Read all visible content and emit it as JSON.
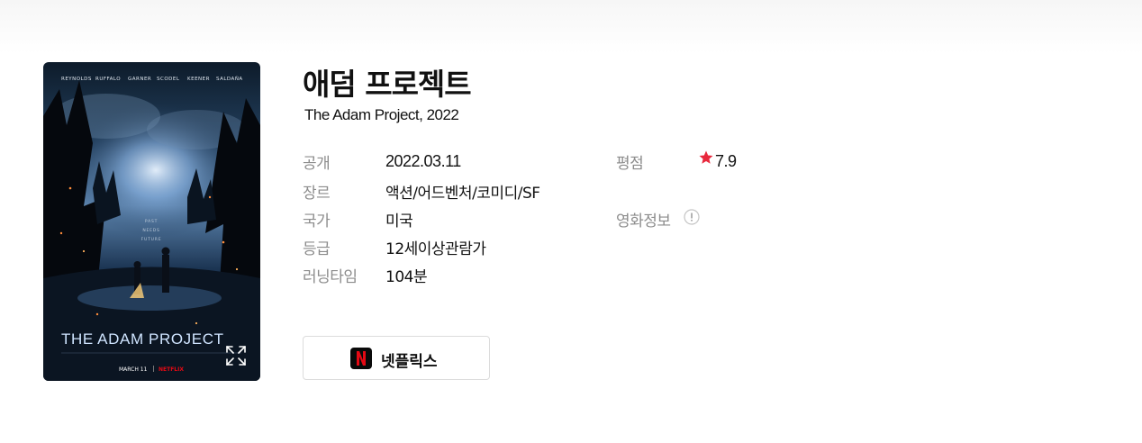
{
  "movie": {
    "title_kr": "애덤 프로젝트",
    "title_en": "The Adam Project, 2022"
  },
  "poster": {
    "cast": [
      "REYNOLDS",
      "RUFFALO",
      "GARNER",
      "SCODEL",
      "KEENER",
      "SALDAÑA"
    ],
    "tagline": [
      "PAST",
      "NEEDS",
      "FUTURE"
    ],
    "logo_text": "THE ADAM PROJECT",
    "release_text": "MARCH 11",
    "brand_text": "NETFLIX"
  },
  "details": {
    "release_label": "공개",
    "release_value": "2022.03.11",
    "genre_label": "장르",
    "genre_value": "액션/어드벤처/코미디/SF",
    "country_label": "국가",
    "country_value": "미국",
    "rating_label": "등급",
    "rating_value": "12세이상관람가",
    "runtime_label": "러닝타임",
    "runtime_value": "104분",
    "score_label": "평점",
    "score_value": "7.9",
    "movie_info_label": "영화정보"
  },
  "ott": {
    "label": "넷플릭스",
    "logo_letter": "N"
  },
  "colors": {
    "star": "#e8283c",
    "netflix_red": "#e50914",
    "label_gray": "#8c8c8c"
  }
}
